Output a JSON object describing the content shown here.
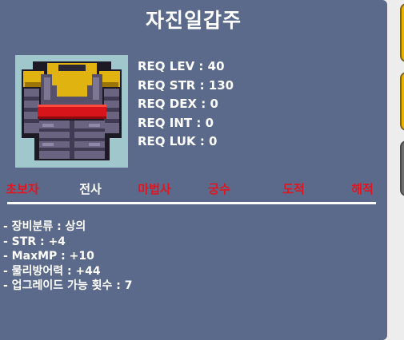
{
  "item": {
    "name": "자진일갑주",
    "icon": "dark-armor-overall-icon",
    "requirements": [
      "REQ LEV : 40",
      "REQ STR : 130",
      "REQ DEX : 0",
      "REQ INT : 0",
      "REQ LUK : 0"
    ],
    "jobs": [
      {
        "label": "초보자",
        "color": "#e4141f"
      },
      {
        "label": "전사",
        "color": "#ffffff"
      },
      {
        "label": "마법사",
        "color": "#e4141f"
      },
      {
        "label": "궁수",
        "color": "#e4141f"
      },
      {
        "label": "도적",
        "color": "#e4141f"
      },
      {
        "label": "해적",
        "color": "#e4141f"
      }
    ],
    "stats": [
      "- 장비분류 : 상의",
      "- STR : +4",
      "- MaxMP : +10",
      "- 물리방어력 : +44",
      "- 업그레이드 가능 횟수 : 7"
    ]
  },
  "colors": {
    "panel_bg": "#5b6a8a",
    "icon_bg": "#9fc7cc",
    "unavailable_job": "#e4141f",
    "available_job": "#ffffff"
  }
}
